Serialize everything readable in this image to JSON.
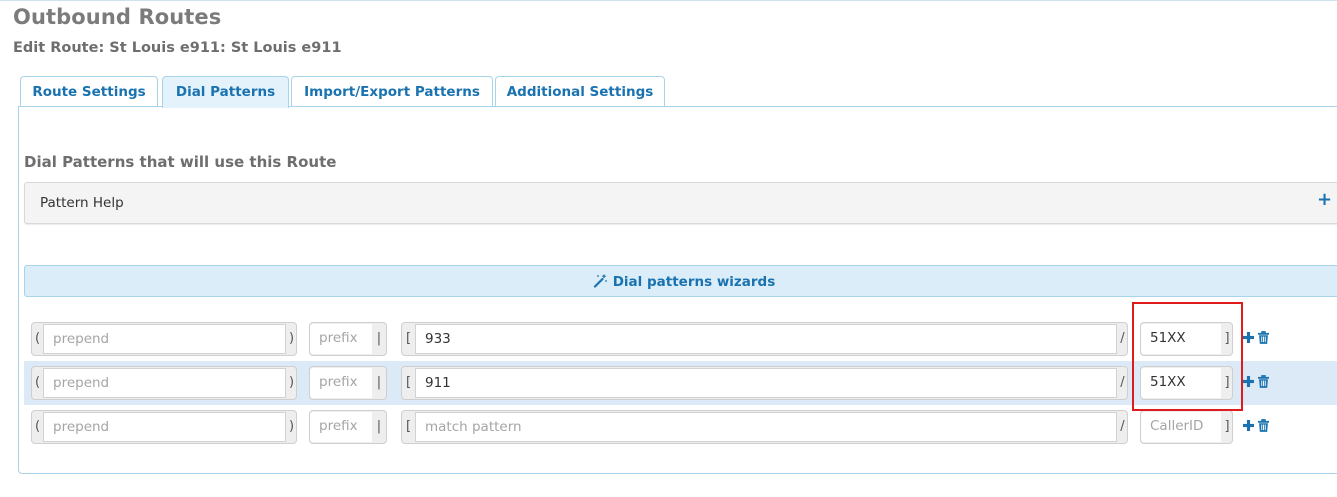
{
  "header": {
    "title": "Outbound Routes",
    "subtitle": "Edit Route: St Louis e911: St Louis e911"
  },
  "tabs": [
    {
      "label": "Route Settings",
      "active": false
    },
    {
      "label": "Dial Patterns",
      "active": true
    },
    {
      "label": "Import/Export Patterns",
      "active": false
    },
    {
      "label": "Additional Settings",
      "active": false
    }
  ],
  "dial_patterns": {
    "section_title": "Dial Patterns that will use this Route",
    "help_label": "Pattern Help",
    "help_toggle": "+",
    "wizard_label": "Dial patterns wizards",
    "wizard_icon": "magic-wand-icon",
    "add_icon": "plus-icon",
    "delete_icon": "trash-icon",
    "addons": {
      "prepend_open": "(",
      "prepend_close": ")",
      "prefix_sep": "|",
      "match_open": "[",
      "match_sep": "/",
      "callerid_close": "]"
    },
    "rows": [
      {
        "prepend": "",
        "prepend_placeholder": "prepend",
        "prefix": "",
        "prefix_placeholder": "prefix",
        "match": "933",
        "match_placeholder": "match pattern",
        "callerid": "51XX",
        "callerid_placeholder": "CallerID",
        "highlighted": false
      },
      {
        "prepend": "",
        "prepend_placeholder": "prepend",
        "prefix": "",
        "prefix_placeholder": "prefix",
        "match": "911",
        "match_placeholder": "match pattern",
        "callerid": "51XX",
        "callerid_placeholder": "CallerID",
        "highlighted": true
      },
      {
        "prepend": "",
        "prepend_placeholder": "prepend",
        "prefix": "",
        "prefix_placeholder": "prefix",
        "match": "",
        "match_placeholder": "match pattern",
        "callerid": "",
        "callerid_placeholder": "CallerID",
        "highlighted": false
      }
    ]
  },
  "colors": {
    "accent": "#1a73b0",
    "tab_border": "#a9d3ea",
    "active_tab_bg": "#e4f2fb",
    "wizard_bg": "#daedf8",
    "row_highlight": "#dbeaf6",
    "annotation_box": "#e01b1b"
  }
}
